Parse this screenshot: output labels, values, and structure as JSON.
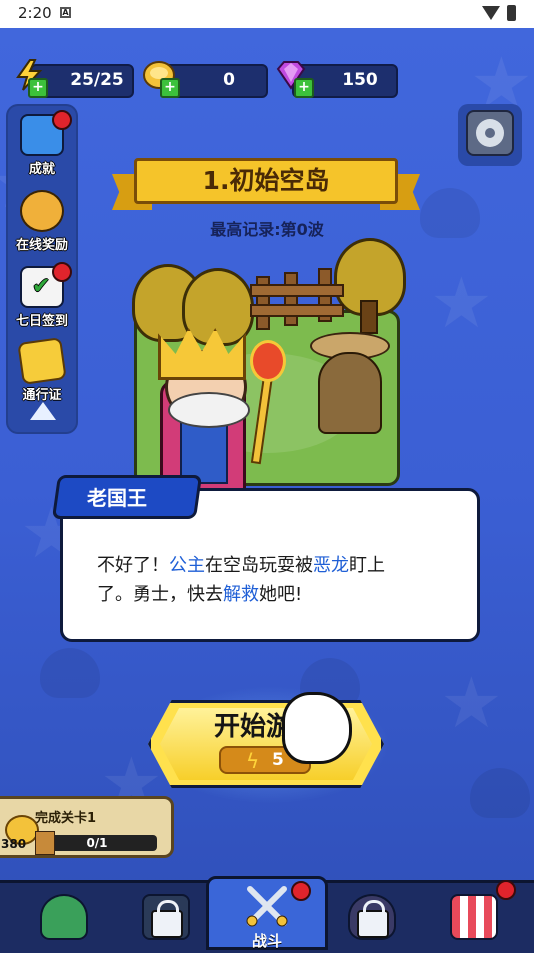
{
  "status_bar": {
    "time": "2:20",
    "notification_icon": "A"
  },
  "resources": {
    "energy": {
      "value": "25/25",
      "icon": "lightning-icon"
    },
    "gold": {
      "value": "0",
      "icon": "gold-coin-icon"
    },
    "gems": {
      "value": "150",
      "icon": "purple-gem-icon"
    },
    "plus_label": "+"
  },
  "sidebar": {
    "items": [
      {
        "label": "成就",
        "icon": "achievement-icon"
      },
      {
        "label": "在线奖励",
        "icon": "stopwatch-icon"
      },
      {
        "label": "七日签到",
        "icon": "calendar-check-icon"
      },
      {
        "label": "通行证",
        "icon": "pass-ticket-icon"
      }
    ]
  },
  "stage": {
    "title": "1.初始空岛",
    "record": "最高记录:第0波"
  },
  "dialog": {
    "speaker": "老国王",
    "line1": [
      "不好了！",
      "公主",
      "在空岛玩耍被",
      "恶龙",
      "盯上"
    ],
    "line2": [
      "了。勇士，快去",
      "解救",
      "她吧!"
    ]
  },
  "start_button": {
    "label": "开始游戏",
    "cost": "5"
  },
  "quest": {
    "title": "完成关卡1",
    "reward": "380",
    "progress": "0/1"
  },
  "bottom_nav": {
    "active_label": "战斗"
  },
  "colors": {
    "accent": "#3b5fd4",
    "button": "#ffe14d",
    "highlight": "#1f5fd6",
    "badge": "#e0242c"
  }
}
